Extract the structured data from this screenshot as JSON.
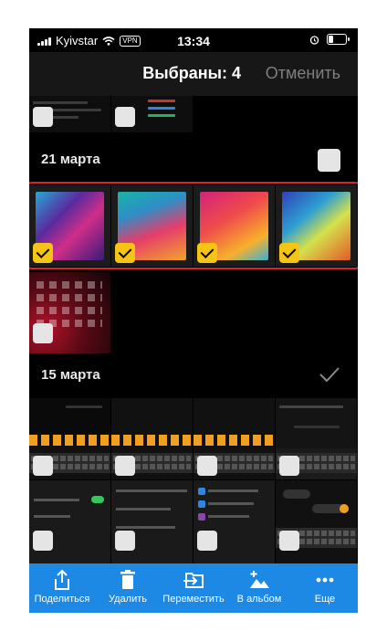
{
  "status_bar": {
    "carrier": "Kyivstar",
    "vpn": "VPN",
    "time": "13:34"
  },
  "nav": {
    "title": "Выбраны: 4",
    "cancel": "Отменить"
  },
  "sections": [
    {
      "date": "21 марта"
    },
    {
      "date": "15 марта"
    }
  ],
  "photos_selected_count": 4,
  "tabbar": {
    "share": "Поделиться",
    "delete": "Удалить",
    "move": "Переместить",
    "album": "В альбом",
    "more": "Еще"
  },
  "colors": {
    "accent": "#1e88e5",
    "check": "#f6c414",
    "highlight": "#d8232a"
  }
}
